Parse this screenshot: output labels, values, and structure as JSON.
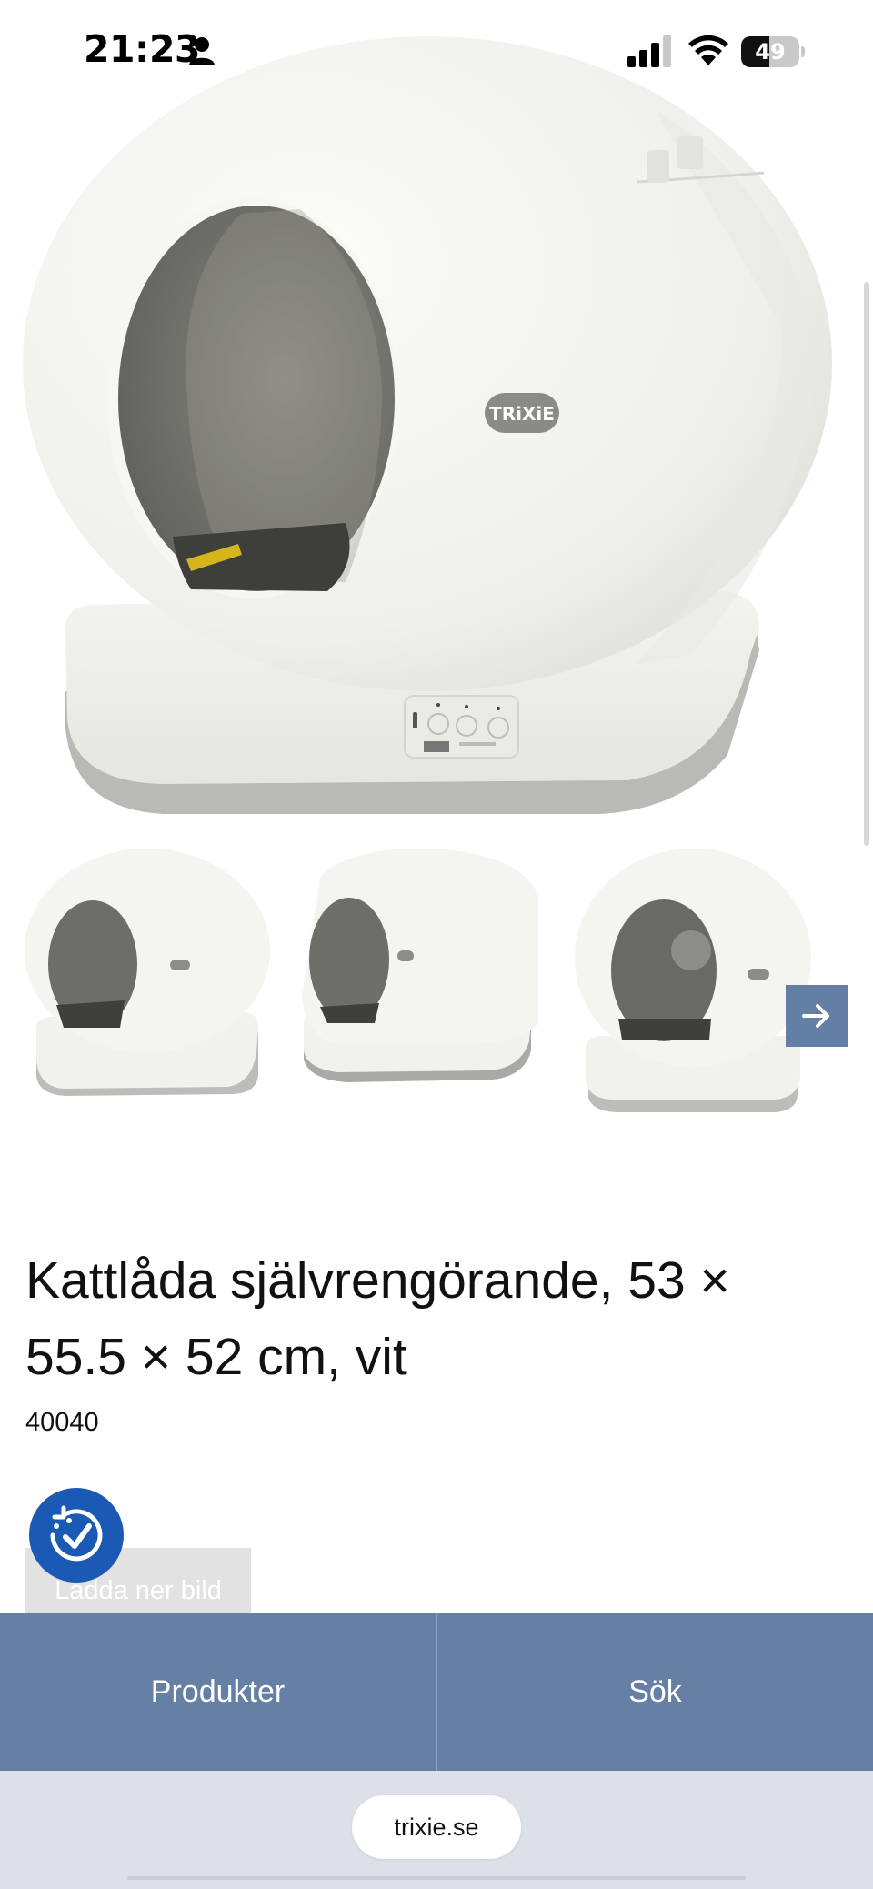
{
  "status_bar": {
    "time": "21:23",
    "battery_level": 49,
    "battery_label": "49",
    "icons": [
      "person-icon",
      "cellular-signal-icon",
      "wifi-icon",
      "battery-icon"
    ]
  },
  "product": {
    "title": "Kattlåda självrengörande, 53 × 55.5 × 52 cm, vit",
    "sku": "40040",
    "brand_logo": "TRiXiE",
    "download_label": "Ladda ner bild"
  },
  "gallery": {
    "thumbnail_count": 3,
    "next_icon": "arrow-right-icon"
  },
  "accessibility": {
    "icon": "accessibility-check-icon"
  },
  "bottom_nav": {
    "products_label": "Produkter",
    "search_label": "Sök",
    "accent_color": "#6680a5"
  },
  "browser": {
    "url": "trixie.se"
  }
}
